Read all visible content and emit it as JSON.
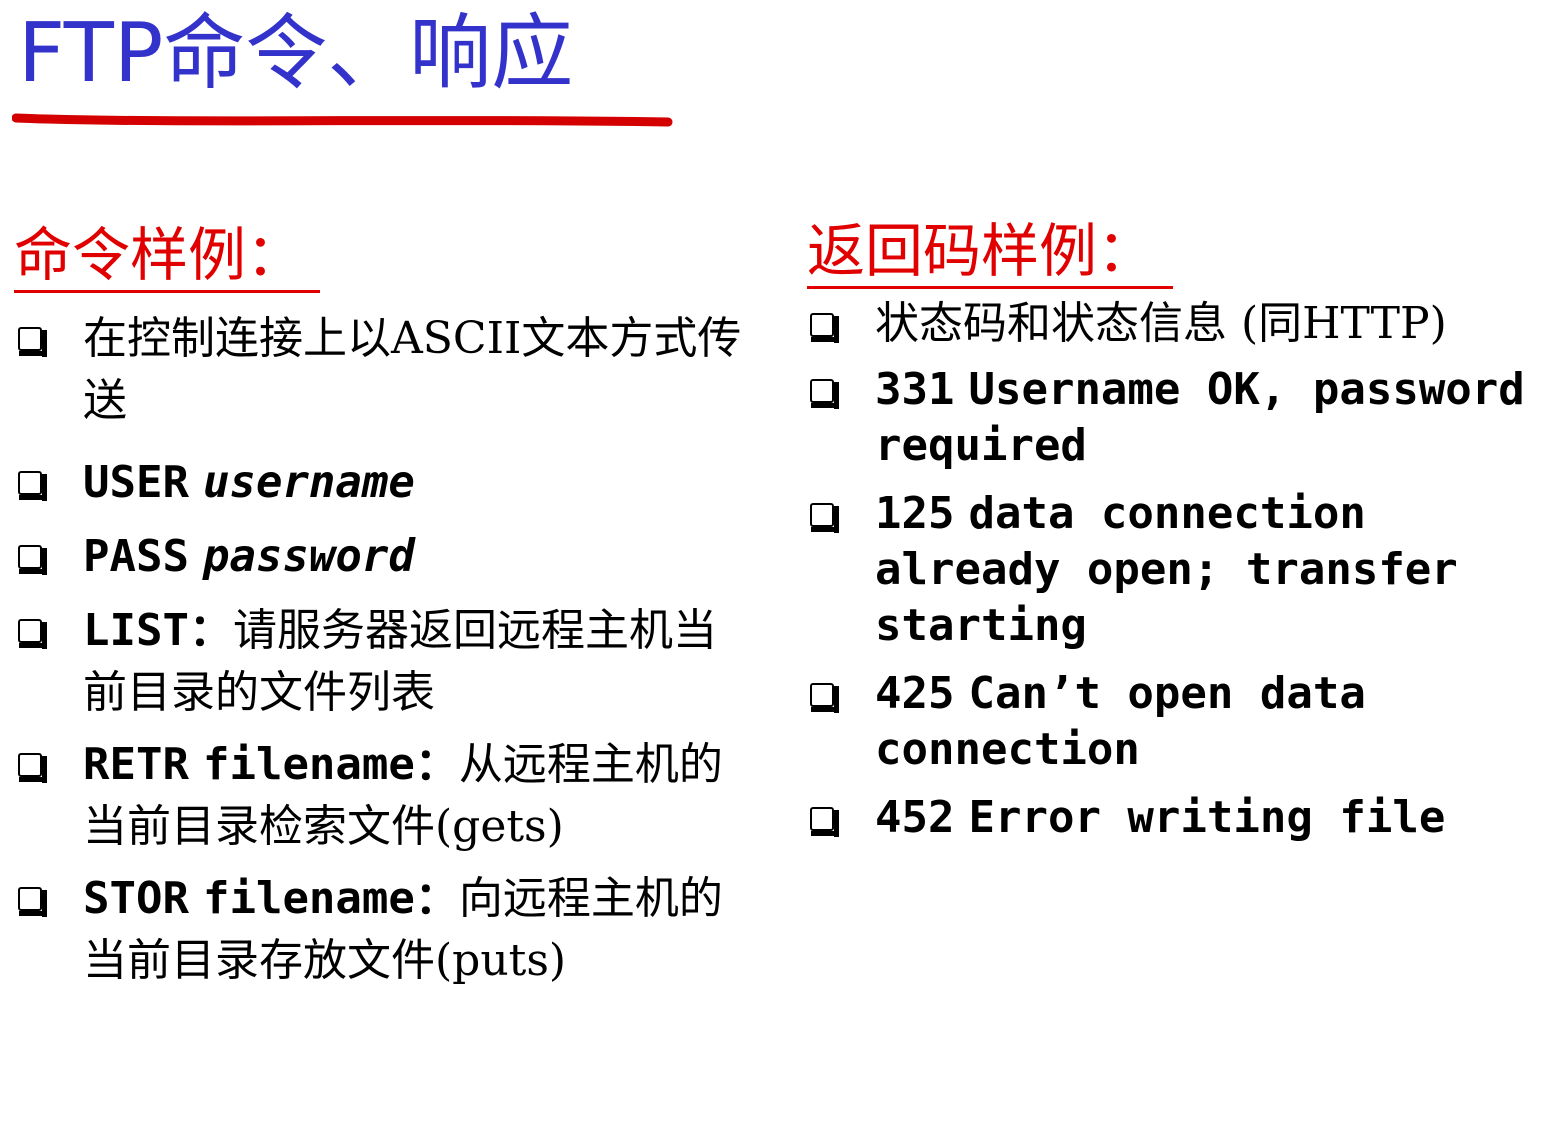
{
  "colors": {
    "title": "#3333cc",
    "heading": "#e00000",
    "underline": "#d40000",
    "text": "#000000"
  },
  "title": "FTP命令、响应",
  "commands": {
    "heading": "命令样例：",
    "items": [
      {
        "text": "在控制连接上以ASCII文本方式传送"
      },
      {
        "keyword": "USER",
        "arg": "username"
      },
      {
        "keyword": "PASS",
        "arg": "password"
      },
      {
        "keyword": "LIST：",
        "desc": "请服务器返回远程主机当前目录的文件列表"
      },
      {
        "keyword": "RETR",
        "arg": "filename：",
        "desc": "从远程主机的当前目录检索文件(gets)"
      },
      {
        "keyword": "STOR",
        "arg": "filename：",
        "desc": "向远程主机的当前目录存放文件(puts)"
      }
    ]
  },
  "responses": {
    "heading": "返回码样例：",
    "items": [
      {
        "text": "状态码和状态信息 (同HTTP)"
      },
      {
        "code": "331",
        "message": "Username OK, password required"
      },
      {
        "code": "125",
        "message": "data connection already open; transfer starting"
      },
      {
        "code": "425",
        "message": "Can’t open data connection"
      },
      {
        "code": "452",
        "message": "Error writing file"
      }
    ]
  }
}
